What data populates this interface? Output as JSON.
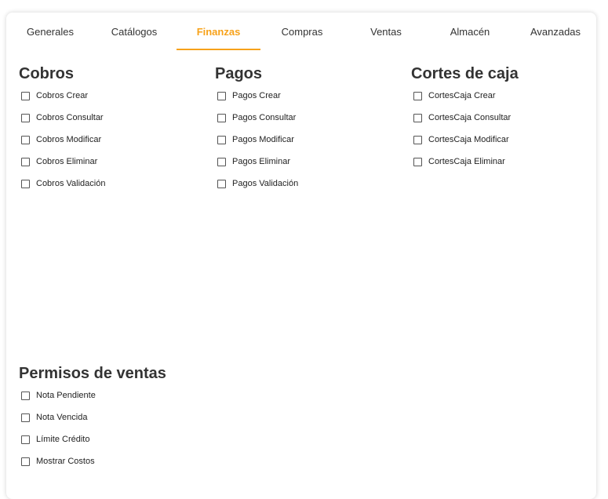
{
  "tabs": [
    {
      "label": "Generales"
    },
    {
      "label": "Catálogos"
    },
    {
      "label": "Finanzas",
      "active": true
    },
    {
      "label": "Compras"
    },
    {
      "label": "Ventas"
    },
    {
      "label": "Almacén"
    },
    {
      "label": "Avanzadas"
    }
  ],
  "accent_color": "#f7a21a",
  "sections": {
    "cobros": {
      "title": "Cobros",
      "items": [
        "Cobros Crear",
        "Cobros Consultar",
        "Cobros Modificar",
        "Cobros Eliminar",
        "Cobros Validación"
      ]
    },
    "pagos": {
      "title": "Pagos",
      "items": [
        "Pagos Crear",
        "Pagos Consultar",
        "Pagos Modificar",
        "Pagos Eliminar",
        "Pagos Validación"
      ]
    },
    "cortes": {
      "title": "Cortes de caja",
      "items": [
        "CortesCaja Crear",
        "CortesCaja Consultar",
        "CortesCaja Modificar",
        "CortesCaja Eliminar"
      ]
    },
    "ventas": {
      "title": "Permisos de ventas",
      "items": [
        "Nota Pendiente",
        "Nota Vencida",
        "Límite Crédito",
        "Mostrar Costos"
      ]
    }
  }
}
